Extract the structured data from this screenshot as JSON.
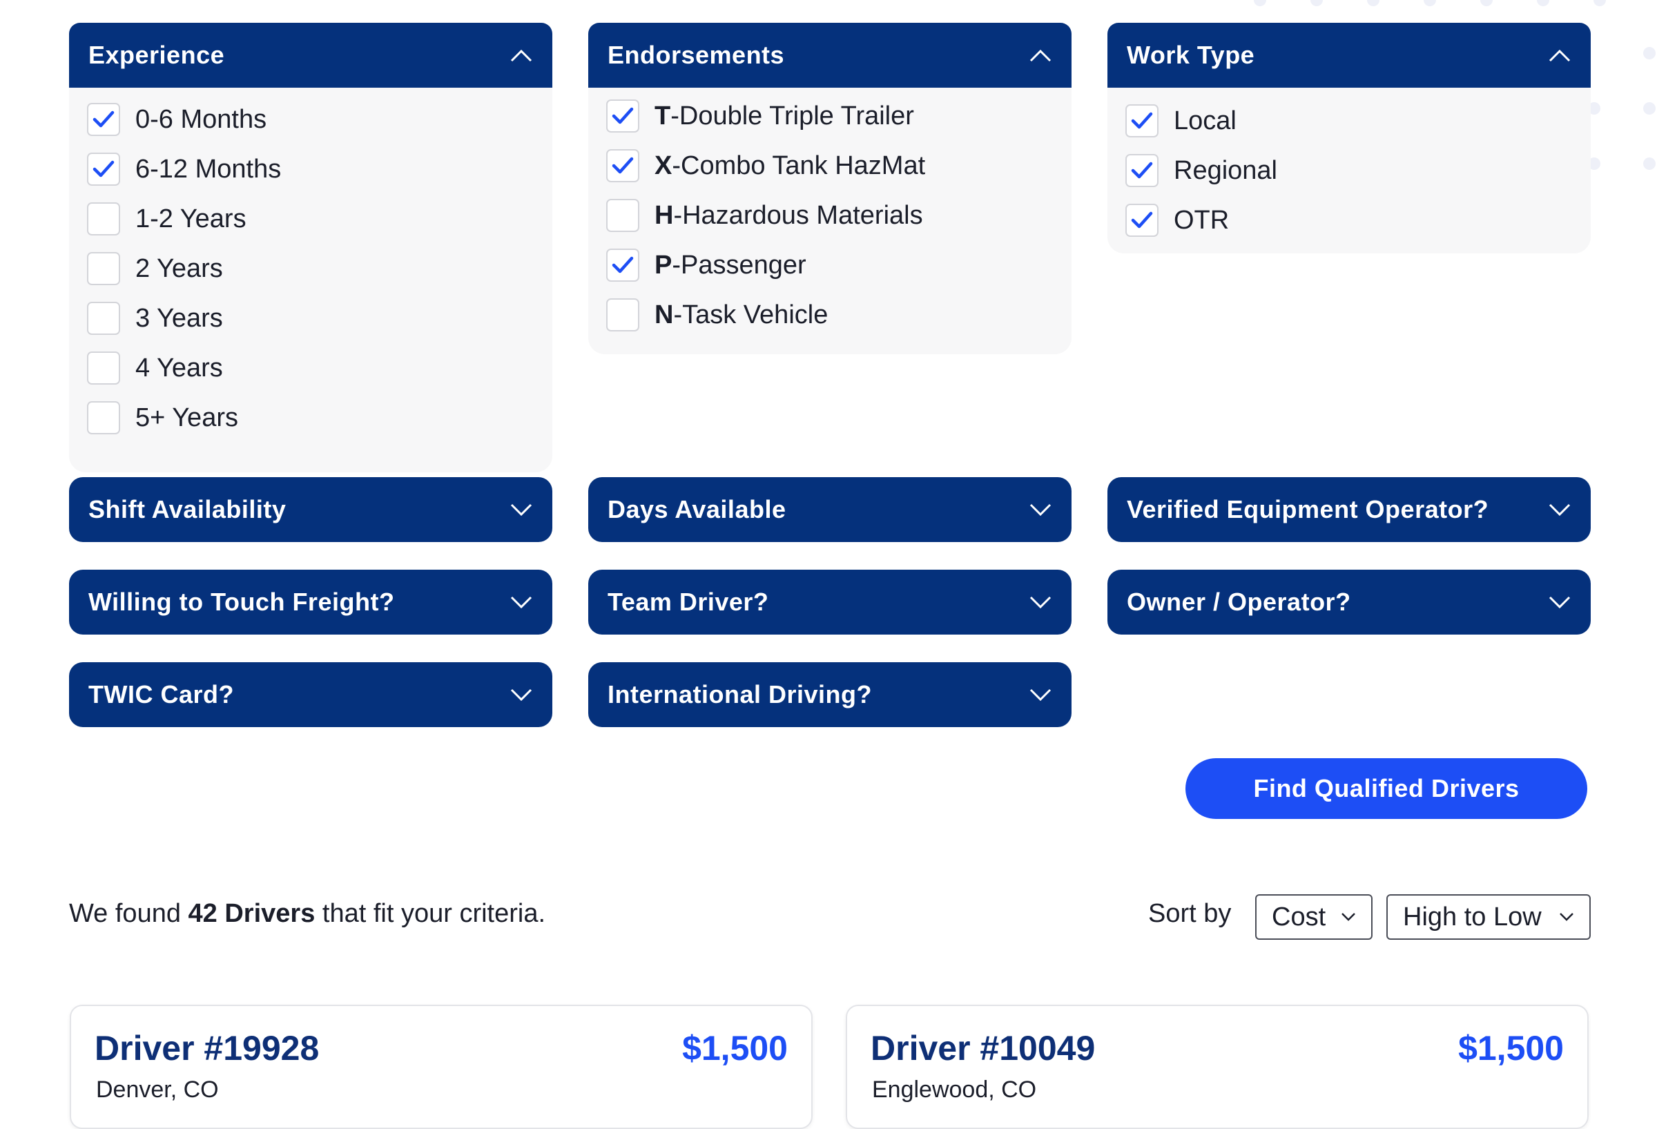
{
  "colors": {
    "header_navy": "#05317c",
    "accent_blue": "#1d4ef5",
    "panel_bg": "#f7f7f8"
  },
  "experience": {
    "title": "Experience",
    "options": [
      {
        "label": "0-6 Months",
        "checked": true
      },
      {
        "label": "6-12 Months",
        "checked": true
      },
      {
        "label": "1-2 Years",
        "checked": false
      },
      {
        "label": "2 Years",
        "checked": false
      },
      {
        "label": "3 Years",
        "checked": false
      },
      {
        "label": "4 Years",
        "checked": false
      },
      {
        "label": "5+ Years",
        "checked": false
      }
    ]
  },
  "endorsements": {
    "title": "Endorsements",
    "options": [
      {
        "code": "T",
        "label": "-Double Triple Trailer",
        "checked": true
      },
      {
        "code": "X",
        "label": "-Combo Tank HazMat",
        "checked": true
      },
      {
        "code": "H",
        "label": "-Hazardous Materials",
        "checked": false
      },
      {
        "code": "P",
        "label": "-Passenger",
        "checked": true
      },
      {
        "code": "N",
        "label": "-Task Vehicle",
        "checked": false
      }
    ]
  },
  "work_type": {
    "title": "Work Type",
    "options": [
      {
        "label": "Local",
        "checked": true
      },
      {
        "label": "Regional",
        "checked": true
      },
      {
        "label": "OTR",
        "checked": true
      }
    ]
  },
  "collapsed_filters": [
    "Shift Availability",
    "Days Available",
    "Verified Equipment Operator?",
    "Willing to Touch Freight?",
    "Team Driver?",
    "Owner / Operator?",
    "TWIC Card?",
    "International Driving?"
  ],
  "cta_label": "Find Qualified Drivers",
  "results": {
    "prefix": "We found",
    "count_text": "42 Drivers",
    "suffix": "that fit your criteria."
  },
  "sort": {
    "label": "Sort by",
    "field": "Cost",
    "order": "High to Low"
  },
  "drivers": [
    {
      "name": "Driver #19928",
      "price": "$1,500",
      "location": "Denver, CO"
    },
    {
      "name": "Driver #10049",
      "price": "$1,500",
      "location": "Englewood, CO"
    }
  ]
}
